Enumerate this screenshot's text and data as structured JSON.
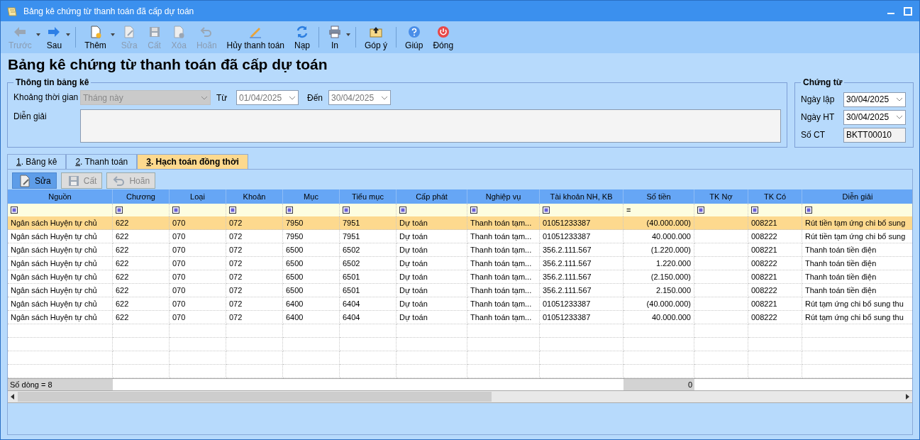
{
  "window": {
    "title": "Bảng kê chứng từ thanh toán đã cấp dự toán"
  },
  "toolbar": {
    "groups": [
      [
        {
          "label": "Trước",
          "disabled": true,
          "dropdown": true
        },
        {
          "label": "Sau",
          "disabled": false,
          "dropdown": true
        }
      ],
      [
        {
          "label": "Thêm",
          "disabled": false,
          "dropdown": true
        },
        {
          "label": "Sửa",
          "disabled": true,
          "dropdown": false
        },
        {
          "label": "Cất",
          "disabled": true,
          "dropdown": false
        },
        {
          "label": "Xóa",
          "disabled": true,
          "dropdown": false
        },
        {
          "label": "Hoãn",
          "disabled": true,
          "dropdown": false
        },
        {
          "label": "Hủy thanh toán",
          "disabled": false,
          "dropdown": false
        },
        {
          "label": "Nạp",
          "disabled": false,
          "dropdown": false
        }
      ],
      [
        {
          "label": "In",
          "disabled": false,
          "dropdown": true
        }
      ],
      [
        {
          "label": "Góp ý",
          "disabled": false,
          "dropdown": false
        }
      ],
      [
        {
          "label": "Giúp",
          "disabled": false,
          "dropdown": false
        },
        {
          "label": "Đóng",
          "disabled": false,
          "dropdown": false
        }
      ]
    ]
  },
  "heading": "Bảng kê chứng từ thanh toán đã cấp dự toán",
  "info": {
    "title": "Thông tin bảng kê",
    "period_label": "Khoảng thời gian",
    "period": {
      "value": "Tháng này",
      "disabled": true
    },
    "from_label": "Từ",
    "from": "01/04/2025",
    "to_label": "Đến",
    "to": "30/04/2025",
    "note_label": "Diễn giải"
  },
  "voucher": {
    "title": "Chứng từ",
    "fields": [
      {
        "label": "Ngày lập",
        "value": "30/04/2025",
        "kind": "date"
      },
      {
        "label": "Ngày HT",
        "value": "30/04/2025",
        "kind": "date"
      },
      {
        "label": "Số CT",
        "value": "BKTT00010",
        "kind": "text"
      }
    ]
  },
  "tabs": [
    {
      "label": "1. Bảng kê",
      "selected": false
    },
    {
      "label": "2. Thanh toán",
      "selected": false
    },
    {
      "label": "3. Hạch toán đồng thời",
      "selected": true
    }
  ],
  "grid_toolbar": [
    {
      "label": "Sửa",
      "disabled": false,
      "active": true
    },
    {
      "label": "Cất",
      "disabled": true,
      "active": false
    },
    {
      "label": "Hoãn",
      "disabled": true,
      "active": false
    }
  ],
  "table": {
    "columns": [
      {
        "label": "Nguồn"
      },
      {
        "label": "Chương"
      },
      {
        "label": "Loại"
      },
      {
        "label": "Khoản"
      },
      {
        "label": "Mục"
      },
      {
        "label": "Tiểu mục"
      },
      {
        "label": "Cấp phát"
      },
      {
        "label": "Nghiệp vụ"
      },
      {
        "label": "Tài khoản NH, KB"
      },
      {
        "label": "Số tiền",
        "filter_operator": "="
      },
      {
        "label": "TK Nợ"
      },
      {
        "label": "TK Có"
      },
      {
        "label": "Diễn giải"
      }
    ],
    "rows": [
      {
        "selected": true,
        "cells": [
          "Ngân sách Huyện tự chủ",
          "622",
          "070",
          "072",
          "7950",
          "7951",
          "Dự toán",
          "Thanh toán tạm...",
          "01051233387",
          "(40.000.000)",
          "",
          "008221",
          "Rút tiền tạm ứng chi bổ sung"
        ]
      },
      {
        "selected": false,
        "cells": [
          "Ngân sách Huyện tự chủ",
          "622",
          "070",
          "072",
          "7950",
          "7951",
          "Dự toán",
          "Thanh toán tạm...",
          "01051233387",
          "40.000.000",
          "",
          "008222",
          "Rút tiền tạm ứng chi bổ sung"
        ]
      },
      {
        "selected": false,
        "cells": [
          "Ngân sách Huyện tự chủ",
          "622",
          "070",
          "072",
          "6500",
          "6502",
          "Dự toán",
          "Thanh toán tạm...",
          "356.2.111.567",
          "(1.220.000)",
          "",
          "008221",
          "Thanh toán tiền điện"
        ]
      },
      {
        "selected": false,
        "cells": [
          "Ngân sách Huyện tự chủ",
          "622",
          "070",
          "072",
          "6500",
          "6502",
          "Dự toán",
          "Thanh toán tạm...",
          "356.2.111.567",
          "1.220.000",
          "",
          "008222",
          "Thanh toán tiền điện"
        ]
      },
      {
        "selected": false,
        "cells": [
          "Ngân sách Huyện tự chủ",
          "622",
          "070",
          "072",
          "6500",
          "6501",
          "Dự toán",
          "Thanh toán tạm...",
          "356.2.111.567",
          "(2.150.000)",
          "",
          "008221",
          "Thanh toán tiền điện"
        ]
      },
      {
        "selected": false,
        "cells": [
          "Ngân sách Huyện tự chủ",
          "622",
          "070",
          "072",
          "6500",
          "6501",
          "Dự toán",
          "Thanh toán tạm...",
          "356.2.111.567",
          "2.150.000",
          "",
          "008222",
          "Thanh toán tiền điện"
        ]
      },
      {
        "selected": false,
        "cells": [
          "Ngân sách Huyện tự chủ",
          "622",
          "070",
          "072",
          "6400",
          "6404",
          "Dự toán",
          "Thanh toán tạm...",
          "01051233387",
          "(40.000.000)",
          "",
          "008221",
          "Rút tạm ứng chi bổ sung thu"
        ]
      },
      {
        "selected": false,
        "cells": [
          "Ngân sách Huyện tự chủ",
          "622",
          "070",
          "072",
          "6400",
          "6404",
          "Dự toán",
          "Thanh toán tạm...",
          "01051233387",
          "40.000.000",
          "",
          "008222",
          "Rút tạm ứng chi bổ sung thu"
        ]
      }
    ],
    "footer": {
      "row_count": "Số dòng = 8",
      "total": "0"
    }
  }
}
